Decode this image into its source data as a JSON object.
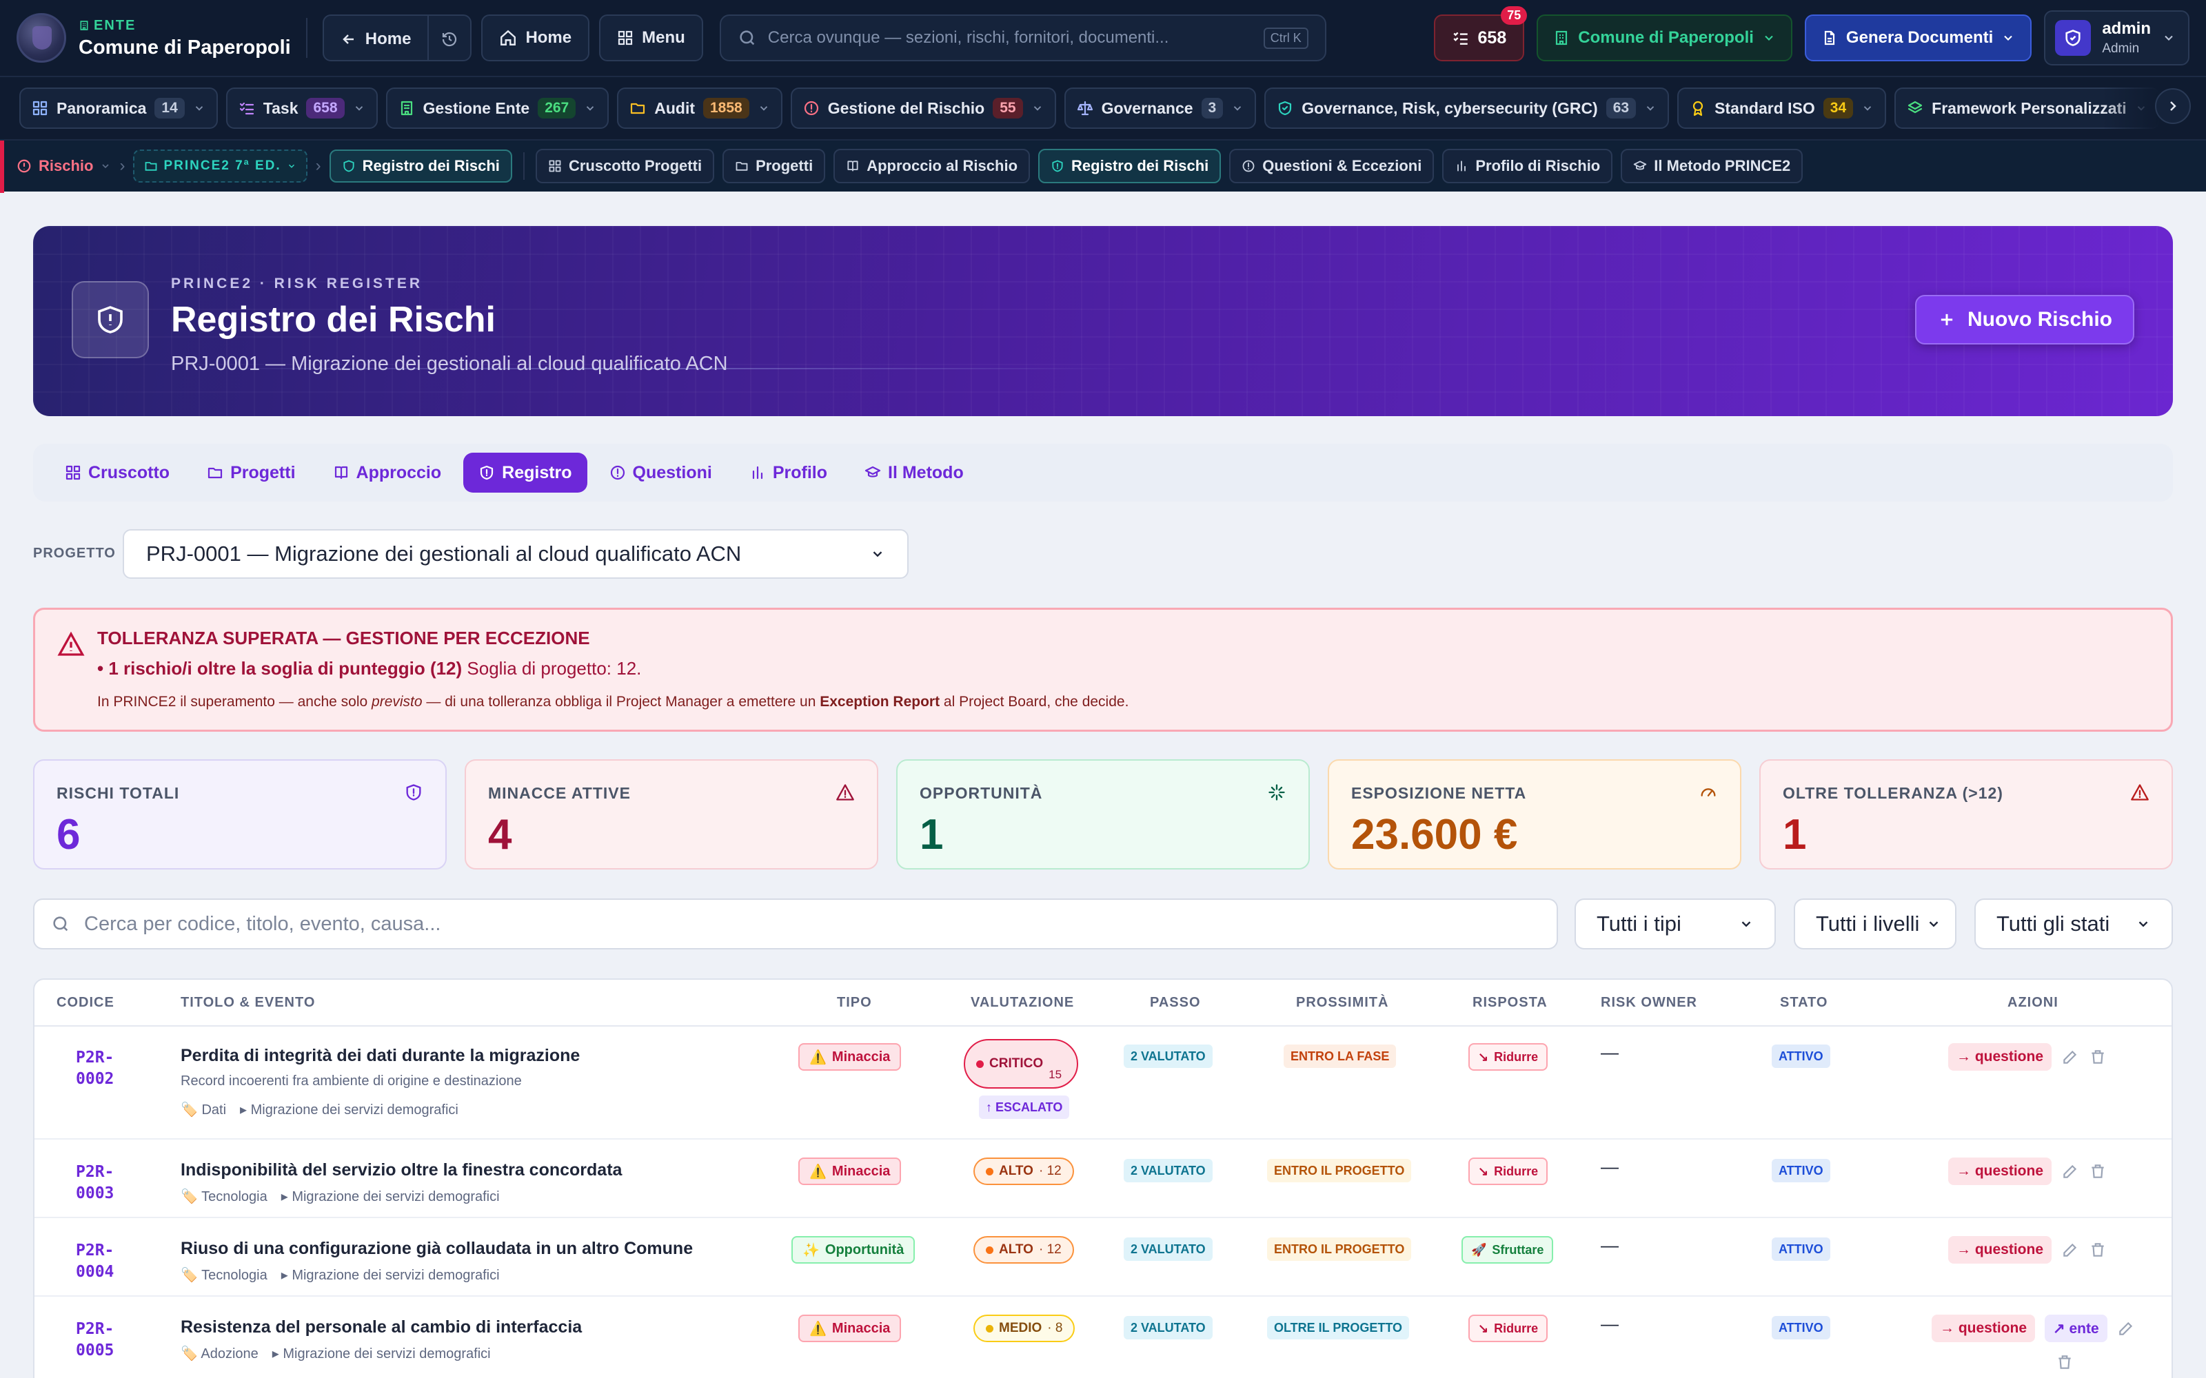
{
  "topbar": {
    "org_kicker": "ENTE",
    "org_name": "Comune di Paperopoli",
    "back_label": "Home",
    "home_label": "Home",
    "menu_label": "Menu",
    "search_placeholder": "Cerca ovunque — sezioni, rischi, fornitori, documenti...",
    "search_shortcut": "Ctrl K",
    "task_count": "658",
    "task_badge": "75",
    "ente_selector": "Comune di Paperopoli",
    "generate_label": "Genera Documenti",
    "user_name": "admin",
    "user_role": "Admin"
  },
  "modules": [
    {
      "label": "Panoramica",
      "count": "14",
      "icon": "grid-icon",
      "count_bg": "#2a3a56",
      "count_fg": "#c7d0e0",
      "icon_color": "#8fb3ff"
    },
    {
      "label": "Task",
      "count": "658",
      "icon": "checklist-icon",
      "count_bg": "#4c2a7a",
      "count_fg": "#c4a8ff",
      "icon_color": "#c084fc"
    },
    {
      "label": "Gestione Ente",
      "count": "267",
      "icon": "building-icon",
      "count_bg": "#14452f",
      "count_fg": "#4ade80",
      "icon_color": "#4ade80"
    },
    {
      "label": "Audit",
      "count": "1858",
      "icon": "folder-icon",
      "count_bg": "#4a3418",
      "count_fg": "#fdba74",
      "icon_color": "#fbbf24"
    },
    {
      "label": "Gestione del Rischio",
      "count": "55",
      "icon": "alert-circle-icon",
      "count_bg": "#5a1f2a",
      "count_fg": "#fda4af",
      "icon_color": "#fb7185"
    },
    {
      "label": "Governance",
      "count": "3",
      "icon": "scale-icon",
      "count_bg": "#2a3a56",
      "count_fg": "#c7d0e0",
      "icon_color": "#a5b4fc"
    },
    {
      "label": "Governance, Risk, cybersecurity (GRC)",
      "count": "63",
      "icon": "shield-check-icon",
      "count_bg": "#2a3a56",
      "count_fg": "#c7d0e0",
      "icon_color": "#2dd4bf"
    },
    {
      "label": "Standard ISO",
      "count": "34",
      "icon": "award-icon",
      "count_bg": "#4a3a12",
      "count_fg": "#facc15",
      "icon_color": "#facc15"
    },
    {
      "label": "Framework Personalizzati",
      "count": "",
      "icon": "layers-icon",
      "count_bg": "#2a3a56",
      "count_fg": "#c7d0e0",
      "icon_color": "#4ade80"
    }
  ],
  "subnav": {
    "crumb_risk": "Rischio",
    "crumb_prince": "PRINCE2 7ª ED.",
    "crumb_active": "Registro dei Rischi",
    "items": [
      {
        "label": "Cruscotto Progetti",
        "icon": "grid-icon"
      },
      {
        "label": "Progetti",
        "icon": "folder-icon"
      },
      {
        "label": "Approccio al Rischio",
        "icon": "book-icon"
      },
      {
        "label": "Registro dei Rischi",
        "icon": "shield-icon",
        "active": true
      },
      {
        "label": "Questioni & Eccezioni",
        "icon": "alert-circle-icon"
      },
      {
        "label": "Profilo di Rischio",
        "icon": "bar-chart-icon"
      },
      {
        "label": "Il Metodo PRINCE2",
        "icon": "graduation-cap-icon"
      }
    ]
  },
  "hero": {
    "kicker": "PRINCE2 · RISK REGISTER",
    "title": "Registro dei Rischi",
    "subtitle": "PRJ-0001 — Migrazione dei gestionali al cloud qualificato ACN",
    "new_button": "Nuovo Rischio"
  },
  "tabs": [
    {
      "label": "Cruscotto",
      "icon": "grid-icon"
    },
    {
      "label": "Progetti",
      "icon": "folder-icon"
    },
    {
      "label": "Approccio",
      "icon": "book-icon"
    },
    {
      "label": "Registro",
      "icon": "shield-icon",
      "active": true
    },
    {
      "label": "Questioni",
      "icon": "alert-circle-icon"
    },
    {
      "label": "Profilo",
      "icon": "bar-chart-icon"
    },
    {
      "label": "Il Metodo",
      "icon": "graduation-cap-icon"
    }
  ],
  "project": {
    "label": "PROGETTO",
    "selected": "PRJ-0001 — Migrazione dei gestionali al cloud qualificato ACN"
  },
  "alert": {
    "heading": "TOLLERANZA SUPERATA — GESTIONE PER ECCEZIONE",
    "bullet_strong": "• 1 rischio/i oltre la soglia di punteggio (12)",
    "bullet_rest": "Soglia di progetto: 12.",
    "note_a": "In PRINCE2 il superamento — anche solo ",
    "note_em": "previsto",
    "note_b": " — di una tolleranza obbliga il Project Manager a emettere un ",
    "note_strong": "Exception Report",
    "note_c": " al Project Board, che decide."
  },
  "stats": [
    {
      "label": "RISCHI TOTALI",
      "value": "6",
      "icon": "shield-icon",
      "bg": "#f4f2fd",
      "border": "#d9d3f5",
      "fg": "#6d28d9",
      "label_fg": "#4b5568"
    },
    {
      "label": "MINACCE ATTIVE",
      "value": "4",
      "icon": "alert-triangle-icon",
      "bg": "#fdf0f1",
      "border": "#f6cdd3",
      "fg": "#9f1239",
      "label_fg": "#4b5568"
    },
    {
      "label": "OPPORTUNITÀ",
      "value": "1",
      "icon": "sparkle-icon",
      "bg": "#eefbf4",
      "border": "#b9ebd0",
      "fg": "#065f46",
      "label_fg": "#4b5568"
    },
    {
      "label": "ESPOSIZIONE NETTA",
      "value": "23.600 €",
      "icon": "gauge-icon",
      "bg": "#fff7ec",
      "border": "#fbd9ad",
      "fg": "#b45309",
      "label_fg": "#4b5568"
    },
    {
      "label": "OLTRE TOLLERANZA (>12)",
      "value": "1",
      "icon": "alert-triangle-icon",
      "bg": "#fdf0f1",
      "border": "#f6cdd3",
      "fg": "#b91c1c",
      "label_fg": "#4b5568"
    }
  ],
  "filters": {
    "search_placeholder": "Cerca per codice, titolo, evento, causa...",
    "type": "Tutti i tipi",
    "level": "Tutti i livelli",
    "status": "Tutti gli stati"
  },
  "table": {
    "headers": {
      "code": "CODICE",
      "title": "TITOLO & EVENTO",
      "type": "TIPO",
      "rating": "VALUTAZIONE",
      "step": "PASSO",
      "proximity": "PROSSIMITÀ",
      "response": "RISPOSTA",
      "owner": "RISK OWNER",
      "status": "STATO",
      "actions": "AZIONI"
    },
    "rows": [
      {
        "code_a": "P2R-",
        "code_b": "0002",
        "title": "Perdita di integrità dei dati durante la migrazione",
        "desc": "Record incoerenti fra ambiente di origine e destinazione",
        "category": "Dati",
        "project": "▸ Migrazione dei servizi demografici",
        "type": "Minaccia",
        "type_icon": "⚠️",
        "level": "CRITICO",
        "score": "15",
        "escalated": "↑ ESCALATO",
        "step": "2 VALUTATO",
        "proximity": "ENTRO LA FASE",
        "response": "Ridurre",
        "owner": "—",
        "status": "ATTIVO",
        "action_issue": "→ questione",
        "action_ente": ""
      },
      {
        "code_a": "P2R-",
        "code_b": "0003",
        "title": "Indisponibilità del servizio oltre la finestra concordata",
        "desc": "",
        "category": "Tecnologia",
        "project": "▸ Migrazione dei servizi demografici",
        "type": "Minaccia",
        "type_icon": "⚠️",
        "level": "ALTO",
        "score": "· 12",
        "escalated": "",
        "step": "2 VALUTATO",
        "proximity": "ENTRO IL PROGETTO",
        "response": "Ridurre",
        "owner": "—",
        "status": "ATTIVO",
        "action_issue": "→ questione",
        "action_ente": ""
      },
      {
        "code_a": "P2R-",
        "code_b": "0004",
        "title": "Riuso di una configurazione già collaudata in un altro Comune",
        "desc": "",
        "category": "Tecnologia",
        "project": "▸ Migrazione dei servizi demografici",
        "type": "Opportunità",
        "type_icon": "✨",
        "level": "ALTO",
        "score": "· 12",
        "escalated": "",
        "step": "2 VALUTATO",
        "proximity": "ENTRO IL PROGETTO",
        "response": "Sfruttare",
        "owner": "—",
        "status": "ATTIVO",
        "action_issue": "→ questione",
        "action_ente": ""
      },
      {
        "code_a": "P2R-",
        "code_b": "0005",
        "title": "Resistenza del personale al cambio di interfaccia",
        "desc": "",
        "category": "Adozione",
        "project": "▸ Migrazione dei servizi demografici",
        "type": "Minaccia",
        "type_icon": "⚠️",
        "level": "MEDIO",
        "score": "· 8",
        "escalated": "",
        "step": "2 VALUTATO",
        "proximity": "OLTRE IL PROGETTO",
        "response": "Ridurre",
        "owner": "—",
        "status": "ATTIVO",
        "action_issue": "→ questione",
        "action_ente": "↗ ente"
      }
    ]
  }
}
